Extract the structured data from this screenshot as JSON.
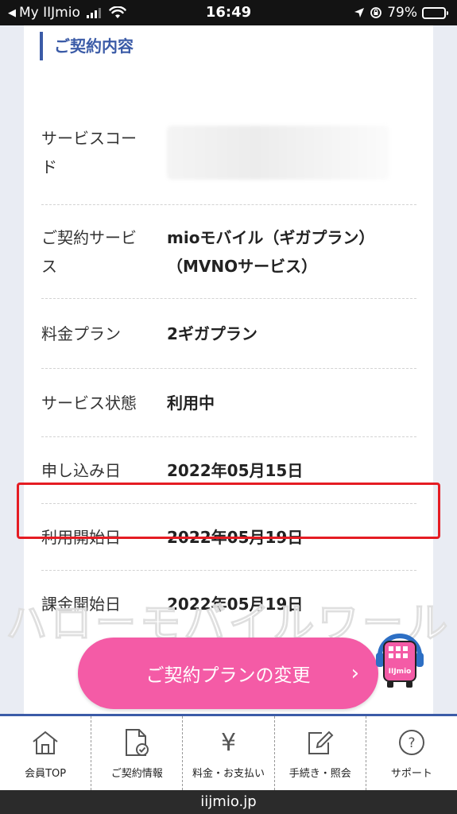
{
  "status_bar": {
    "back_app": "My IIJmio",
    "time": "16:49",
    "battery_percent": "79%",
    "battery_level": 0.79
  },
  "section": {
    "title": "ご契約内容"
  },
  "rows": [
    {
      "label_line1": "サービスコー",
      "label_line2": "ド",
      "value": ""
    },
    {
      "label_line1": "ご契約サービ",
      "label_line2": "ス",
      "value_line1": "mioモバイル（ギガプラン）",
      "value_line2": "（MVNOサービス）"
    },
    {
      "label": "料金プラン",
      "value": "2ギガプラン"
    },
    {
      "label": "サービス状態",
      "value": "利用中"
    },
    {
      "label": "申し込み日",
      "value": "2022年05月15日"
    },
    {
      "label": "利用開始日",
      "value": "2022年05月19日"
    },
    {
      "label": "課金開始日",
      "value": "2022年05月19日"
    }
  ],
  "watermark": "ハローモバイルワールド",
  "change_button": {
    "label": "ご契約プランの変更",
    "chevron": "›"
  },
  "mascot": {
    "text": "IIJmio",
    "icon": "iijmio-mascot-icon"
  },
  "bottom_nav": [
    {
      "label": "会員TOP",
      "icon": "home-icon"
    },
    {
      "label": "ご契約情報",
      "icon": "contract-doc-icon"
    },
    {
      "label": "料金・お支払い",
      "icon": "yen-icon",
      "glyph": "¥"
    },
    {
      "label": "手続き・照会",
      "icon": "edit-form-icon"
    },
    {
      "label": "サポート",
      "icon": "help-icon",
      "glyph": "?"
    }
  ],
  "url": "iijmio.jp",
  "colors": {
    "accent_blue": "#3b5ba7",
    "button_pink": "#f45ba6",
    "highlight_red": "#e51c23"
  }
}
